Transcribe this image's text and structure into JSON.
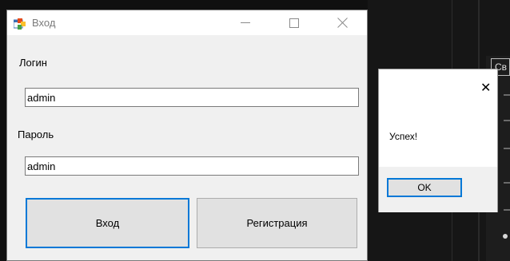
{
  "colors": {
    "accent": "#0078d7",
    "window_bg": "#f0f0f0",
    "desktop_bg": "#101010"
  },
  "login_window": {
    "title": "Вход",
    "icon": "app-form-icon",
    "login_label": "Логин",
    "login_value": "admin",
    "password_label": "Пароль",
    "password_value": "admin",
    "enter_button": "Вход",
    "register_button": "Регистрация",
    "controls": {
      "minimize": "minimize-icon",
      "maximize": "maximize-icon",
      "close": "close-icon"
    }
  },
  "message_box": {
    "message": "Успех!",
    "ok_button": "OK",
    "close_glyph": "✕"
  },
  "background": {
    "partial_box_text": "Св"
  }
}
